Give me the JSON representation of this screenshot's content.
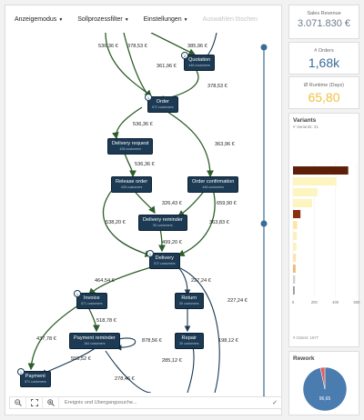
{
  "toolbar": {
    "items": [
      "Anzeigemodus",
      "Sollprozessfilter",
      "Einstellungen"
    ],
    "disabled_item": "Auswahlen löschen"
  },
  "graph": {
    "nodes": [
      {
        "title": "Quotation",
        "sub": "448 customers",
        "badge": "2"
      },
      {
        "title": "Order",
        "sub": "572 customers",
        "badge": "1"
      },
      {
        "title": "Delivery request",
        "sub": "428 customers",
        "badge": ""
      },
      {
        "title": "Release order",
        "sub": "428 customers",
        "badge": ""
      },
      {
        "title": "Order confirmation",
        "sub": "448 customers",
        "badge": ""
      },
      {
        "title": "Delivery reminder",
        "sub": "55 customers",
        "badge": ""
      },
      {
        "title": "Delivery",
        "sub": "572 customers",
        "badge": "1"
      },
      {
        "title": "Invoice",
        "sub": "571 customers",
        "badge": "1"
      },
      {
        "title": "Return",
        "sub": "35 customers",
        "badge": ""
      },
      {
        "title": "Payment reminder",
        "sub": "164 customers",
        "badge": ""
      },
      {
        "title": "Repair",
        "sub": "35 customers",
        "badge": ""
      },
      {
        "title": "Payment",
        "sub": "571 customers",
        "badge": "1"
      }
    ],
    "edge_labels": [
      "536,36 €",
      "378,53 €",
      "385,96 €",
      "361,96 €",
      "378,53 €",
      "536,36 €",
      "536,36 €",
      "363,96 €",
      "326,43 €",
      "659,90 €",
      "538,20 €",
      "363,83 €",
      "499,20 €",
      "464,54 €",
      "227,24 €",
      "227,24 €",
      "518,78 €",
      "437,78 €",
      "878,56 €",
      "555,52 €",
      "285,12 €",
      "198,12 €",
      "278,46 €"
    ]
  },
  "bottombar": {
    "search_placeholder": "Ereignis und Übergangssuche..."
  },
  "kpis": [
    {
      "label": "Sales Revenue",
      "value": "3.071.830 €",
      "color": "#6b7b8c"
    },
    {
      "label": "# Orders",
      "value": "1,68k",
      "color": "#3a6c98"
    },
    {
      "label": "Ø Runtime (Days)",
      "value": "65,80",
      "color": "#f0c040"
    }
  ],
  "variants": {
    "title": "Variants",
    "subtitle": "# Variants: 31",
    "footer": "# Orders: 1677",
    "chart_data": {
      "type": "bar",
      "orientation": "horizontal",
      "values": [
        520,
        410,
        230,
        180,
        70,
        40,
        36,
        32,
        28,
        24,
        20,
        16
      ],
      "colors": [
        "#5c1f08",
        "#fdf5c0",
        "#fdf5c0",
        "#fdf5c0",
        "#8a3010",
        "#fde7a8",
        "#fdf0c0",
        "#fdf0c0",
        "#fce2b0",
        "#f0b870",
        "#d0d0d0",
        "#9a9a9a"
      ],
      "xticks": [
        "0",
        "200",
        "400",
        "600"
      ],
      "xlim": [
        0,
        600
      ]
    }
  },
  "rework": {
    "title": "Rework",
    "chart_data": {
      "type": "pie",
      "values": [
        96.65,
        3.35
      ],
      "colors": [
        "#4a7cb0",
        "#e06060"
      ],
      "label": "96,65"
    }
  }
}
